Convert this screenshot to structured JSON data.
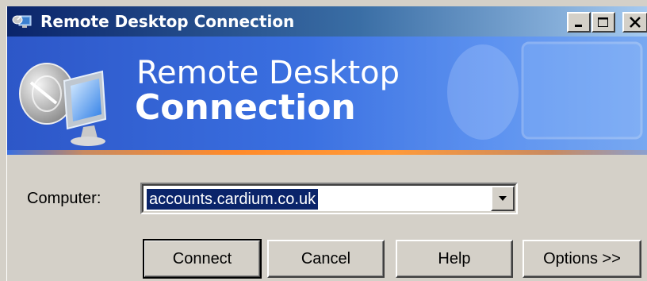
{
  "window": {
    "title": "Remote Desktop Connection",
    "controls": {
      "minimize": "_",
      "maximize": "□",
      "close": "X"
    }
  },
  "banner": {
    "line1": "Remote Desktop",
    "line2": "Connection"
  },
  "form": {
    "computer_label": "Computer:",
    "computer_value": "accounts.cardium.co.uk"
  },
  "buttons": {
    "connect": "Connect",
    "cancel": "Cancel",
    "help": "Help",
    "options": "Options >>"
  },
  "icons": {
    "title": "remote-desktop-icon",
    "banner": "satellite-monitor-icon",
    "dropdown": "chevron-down-icon"
  },
  "colors": {
    "title_bar": "#0a246a",
    "banner": "#3a6fe0",
    "accent_strip": "#ff8a2a",
    "dialog_face": "#d4d0c8",
    "selection": "#0a246a"
  }
}
